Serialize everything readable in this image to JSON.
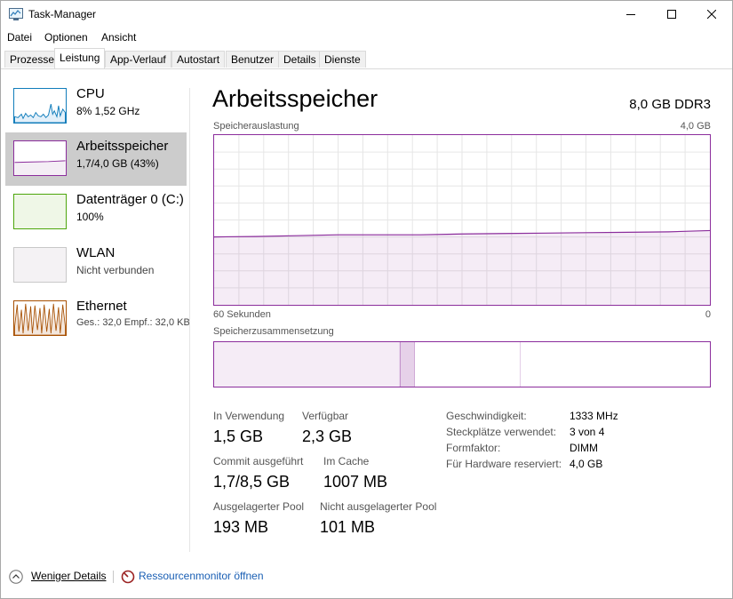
{
  "window": {
    "title": "Task-Manager"
  },
  "menu": [
    "Datei",
    "Optionen",
    "Ansicht"
  ],
  "tabs": [
    "Prozesse",
    "Leistung",
    "App-Verlauf",
    "Autostart",
    "Benutzer",
    "Details",
    "Dienste"
  ],
  "active_tab": "Leistung",
  "sidebar": {
    "items": [
      {
        "title": "CPU",
        "sub": "8%  1,52 GHz",
        "color": "#117dbb"
      },
      {
        "title": "Arbeitsspeicher",
        "sub": "1,7/4,0 GB (43%)",
        "color": "#8b2d9c"
      },
      {
        "title": "Datenträger 0 (C:)",
        "sub": "100%",
        "color": "#4da60c"
      },
      {
        "title": "WLAN",
        "sub": "Nicht verbunden",
        "color": "#a0a0a0"
      },
      {
        "title": "Ethernet",
        "sub": "Ges.: 32,0  Empf.: 32,0 KBit/s",
        "color": "#a74f01"
      }
    ],
    "selected_index": 1
  },
  "main": {
    "title": "Arbeitsspeicher",
    "subtitle": "8,0 GB DDR3",
    "usage_label": "Speicherauslastung",
    "usage_max": "4,0 GB",
    "time_label": "60 Sekunden",
    "time_right": "0",
    "composition_label": "Speicherzusammensetzung"
  },
  "chart_data": {
    "type": "area",
    "title": "Speicherauslastung",
    "x": [
      60,
      55,
      50,
      45,
      40,
      35,
      30,
      25,
      20,
      15,
      10,
      5,
      0
    ],
    "y": [
      1.6,
      1.61,
      1.63,
      1.65,
      1.65,
      1.65,
      1.67,
      1.68,
      1.69,
      1.7,
      1.71,
      1.72,
      1.75
    ],
    "ylim": [
      0,
      4.0
    ],
    "xlabel": "60 Sekunden",
    "grid": true,
    "color": "#8b2d9c"
  },
  "composition": {
    "in_use": 1.5,
    "modified": 0.12,
    "standby": 0.85,
    "free": 1.53
  },
  "stats": {
    "in_use_label": "In Verwendung",
    "in_use": "1,5 GB",
    "available_label": "Verfügbar",
    "available": "2,3 GB",
    "commit_label": "Commit ausgeführt",
    "commit": "1,7/8,5 GB",
    "cache_label": "Im Cache",
    "cache": "1007 MB",
    "paged_label": "Ausgelagerter Pool",
    "paged": "193 MB",
    "nonpaged_label": "Nicht ausgelagerter Pool",
    "nonpaged": "101 MB"
  },
  "info": {
    "speed_label": "Geschwindigkeit:",
    "speed": "1333 MHz",
    "slots_label": "Steckplätze verwendet:",
    "slots": "3 von 4",
    "form_label": "Formfaktor:",
    "form": "DIMM",
    "reserved_label": "Für Hardware reserviert:",
    "reserved": "4,0 GB"
  },
  "footer": {
    "less_details": "Weniger Details",
    "resmon": "Ressourcenmonitor öffnen"
  }
}
